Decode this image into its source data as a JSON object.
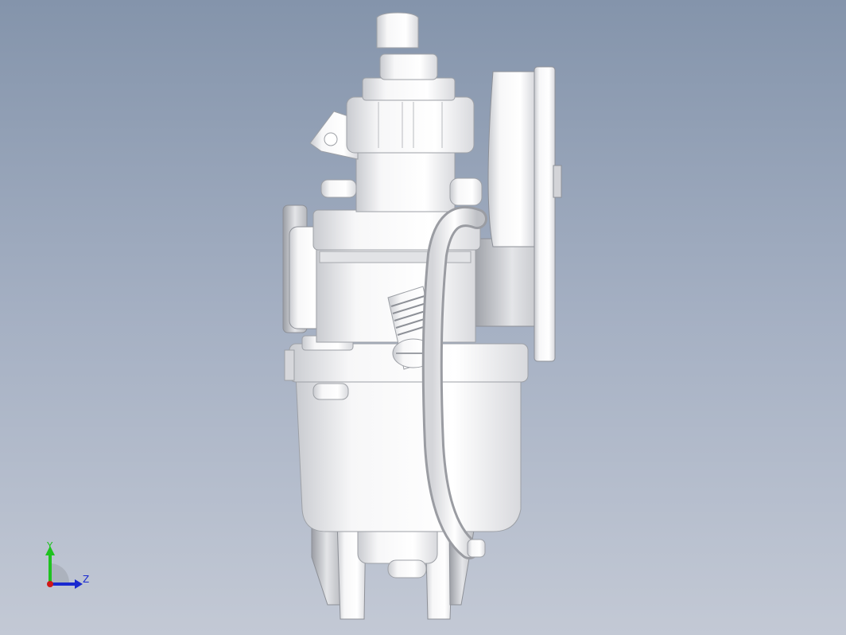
{
  "triad": {
    "y_label": "Y",
    "z_label": "Z",
    "colors": {
      "y": "#1fc21f",
      "z": "#1a2ad0",
      "x": "#d01818"
    }
  },
  "viewport": {
    "background_top": "#8494ab",
    "background_bottom": "#c3c9d5",
    "model_color": "#f2f2f4"
  }
}
